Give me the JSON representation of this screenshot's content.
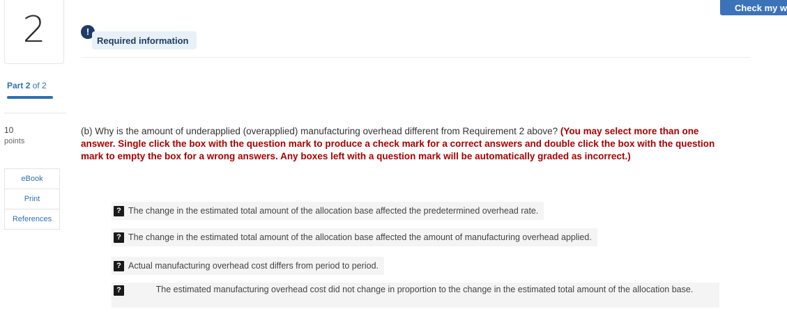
{
  "question_number": "2",
  "check_button_label": "Check my wo",
  "alert_icon_glyph": "!",
  "required_information_label": "Required information",
  "part": {
    "word": "Part",
    "current": "2",
    "of_total": "of 2"
  },
  "points": {
    "value": "10",
    "label": "points"
  },
  "side_links": [
    "eBook",
    "Print",
    "References"
  ],
  "question": {
    "prompt": "(b) Why is the amount of underapplied (overapplied) manufacturing overhead different from Requirement 2 above? ",
    "instructions": "(You may select more than one answer. Single click the box with the question mark to produce a check mark for a correct answers and double click the box with the question mark to empty the box for a wrong answers. Any boxes left with a question mark will be automatically graded as incorrect.)"
  },
  "choices": [
    {
      "box_glyph": "?",
      "text": "The change in the estimated total amount of the allocation base affected the predetermined overhead rate."
    },
    {
      "box_glyph": "?",
      "text": "The change in the estimated total amount of the allocation base affected the amount of manufacturing overhead applied."
    },
    {
      "box_glyph": "?",
      "text": "Actual manufacturing overhead cost differs from period to period."
    },
    {
      "box_glyph": "?",
      "text": "The estimated manufacturing overhead cost did not change in proportion to the change in the estimated total amount of the allocation base."
    }
  ],
  "colors": {
    "accent": "#2f6fb0",
    "instruction_red": "#a80000",
    "alert_navy": "#1f3a66",
    "button_blue": "#3b73b9"
  }
}
